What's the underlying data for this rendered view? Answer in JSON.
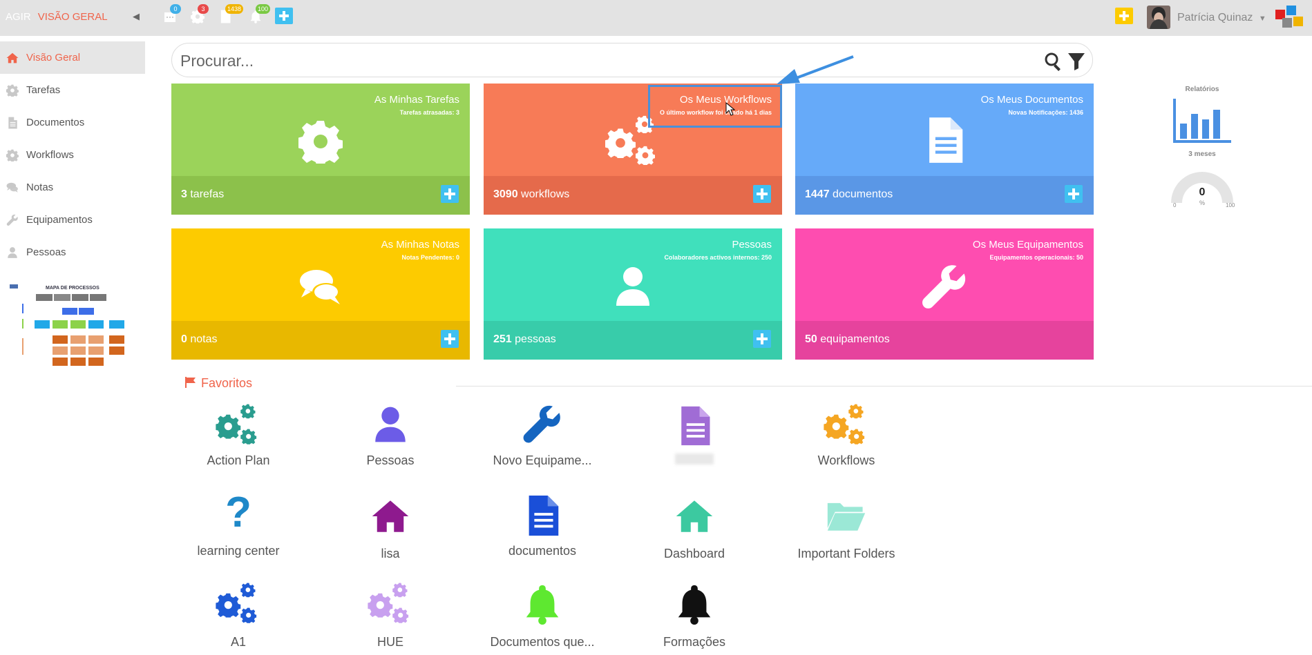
{
  "topbar": {
    "app_name": "AGIR",
    "page_name": "VISÃO GERAL",
    "badges": {
      "calendar": "0",
      "settings": "3",
      "documents": "1438",
      "notifications": "100"
    },
    "user_name": "Patrícia Quinaz"
  },
  "sidebar": {
    "items": [
      {
        "label": "Visão Geral",
        "icon": "home-icon"
      },
      {
        "label": "Tarefas",
        "icon": "gear-icon"
      },
      {
        "label": "Documentos",
        "icon": "document-icon"
      },
      {
        "label": "Workflows",
        "icon": "gears-icon"
      },
      {
        "label": "Notas",
        "icon": "comments-icon"
      },
      {
        "label": "Equipamentos",
        "icon": "wrench-icon"
      },
      {
        "label": "Pessoas",
        "icon": "user-icon"
      }
    ],
    "mapa_title": "MAPA DE PROCESSOS"
  },
  "search": {
    "placeholder": "Procurar..."
  },
  "cards": [
    {
      "title": "As Minhas Tarefas",
      "subtitle": "Tarefas atrasadas: 3",
      "count": "3",
      "unit": "tarefas",
      "color": "#9bd35a",
      "footer_color": "#8cc14b",
      "icon": "gear-icon"
    },
    {
      "title": "Os Meus Workflows",
      "subtitle": "O último workflow foi criado há 1 dias",
      "count": "3090",
      "unit": "workflows",
      "color": "#f77b57",
      "footer_color": "#e56a4b",
      "icon": "gears-icon"
    },
    {
      "title": "Os Meus Documentos",
      "subtitle": "Novas Notificações: 1436",
      "count": "1447",
      "unit": "documentos",
      "color": "#66aaf9",
      "footer_color": "#5a97e6",
      "icon": "document-icon"
    },
    {
      "title": "As Minhas Notas",
      "subtitle": "Notas Pendentes: 0",
      "count": "0",
      "unit": "notas",
      "color": "#fdcb00",
      "footer_color": "#e8b800",
      "icon": "comments-icon"
    },
    {
      "title": "Pessoas",
      "subtitle": "Colaboradores activos internos: 250",
      "count": "251",
      "unit": "pessoas",
      "color": "#40e0bc",
      "footer_color": "#38ccaa",
      "icon": "user-icon"
    },
    {
      "title": "Os Meus Equipamentos",
      "subtitle": "Equipamentos operacionais: 50",
      "count": "50",
      "unit": "equipamentos",
      "color": "#fe4db0",
      "footer_color": "#e6439d",
      "icon": "wrench-icon"
    }
  ],
  "reports": {
    "title": "Relatórios",
    "period": "3 meses",
    "gauge_value": "0",
    "gauge_unit": "%",
    "gauge_min": "0",
    "gauge_max": "100"
  },
  "favorites": {
    "title": "Favoritos",
    "items": [
      {
        "label": "Action Plan",
        "icon": "gears-icon",
        "color": "#2a9d8f"
      },
      {
        "label": "Pessoas",
        "icon": "user-icon",
        "color": "#6c5ce7"
      },
      {
        "label": "Novo Equipame...",
        "icon": "wrench-icon",
        "color": "#1565c0"
      },
      {
        "label": "",
        "icon": "document-icon",
        "color": "#a06cd5"
      },
      {
        "label": "Workflows",
        "icon": "gears-icon",
        "color": "#f5a623"
      },
      {
        "label": "learning center",
        "icon": "question-icon",
        "color": "#1e88c8"
      },
      {
        "label": "lisa",
        "icon": "home-icon",
        "color": "#8e1a8e"
      },
      {
        "label": "documentos",
        "icon": "document-icon",
        "color": "#1a4fd8"
      },
      {
        "label": "Dashboard",
        "icon": "home-icon",
        "color": "#3cc9a0"
      },
      {
        "label": "Important Folders",
        "icon": "folder-icon",
        "color": "#9be8d6"
      },
      {
        "label": "A1",
        "icon": "gears-icon",
        "color": "#1f5bd6"
      },
      {
        "label": "HUE",
        "icon": "gears-icon",
        "color": "#c8a0ef"
      },
      {
        "label": "Documentos que...",
        "icon": "bell-icon",
        "color": "#5ee830"
      },
      {
        "label": "Formações",
        "icon": "bell-icon",
        "color": "#111111"
      }
    ]
  }
}
